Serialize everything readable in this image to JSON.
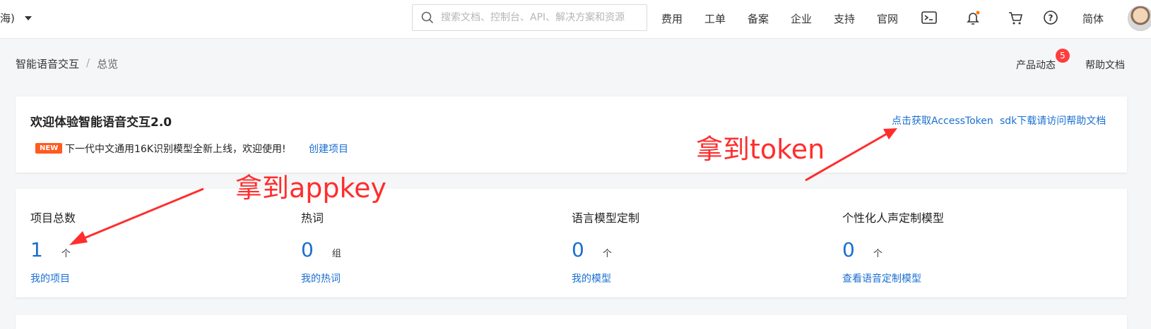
{
  "header": {
    "region_label": "海)",
    "search_placeholder": "搜索文档、控制台、API、解决方案和资源",
    "nav": [
      "费用",
      "工单",
      "备案",
      "企业",
      "支持",
      "官网"
    ],
    "lang_label": "简体",
    "notification_dot_color": "#ff7a00"
  },
  "breadcrumb": {
    "root": "智能语音交互",
    "separator": "/",
    "current": "总览"
  },
  "top_links": {
    "product_news": "产品动态",
    "product_news_badge": "5",
    "help_docs": "帮助文档"
  },
  "welcome": {
    "title": "欢迎体验智能语音交互2.0",
    "new_badge": "NEW",
    "notice": "下一代中文通用16K识别模型全新上线，欢迎使用!",
    "create_link": "创建项目",
    "token_link": "点击获取AccessToken",
    "sdk_link": "sdk下载请访问帮助文档"
  },
  "stats": [
    {
      "title": "项目总数",
      "value": "1",
      "unit": "个",
      "link": "我的项目"
    },
    {
      "title": "热词",
      "value": "0",
      "unit": "组",
      "link": "我的热词"
    },
    {
      "title": "语言模型定制",
      "value": "0",
      "unit": "个",
      "link": "我的模型"
    },
    {
      "title": "个性化人声定制模型",
      "value": "0",
      "unit": "个",
      "link": "查看语音定制模型"
    }
  ],
  "annotations": {
    "appkey": "拿到appkey",
    "token": "拿到token",
    "color": "#ff2d2d"
  },
  "colors": {
    "link": "#1a6fd1",
    "badge": "#ff3d3d",
    "new_badge": "#ff5a1f"
  }
}
